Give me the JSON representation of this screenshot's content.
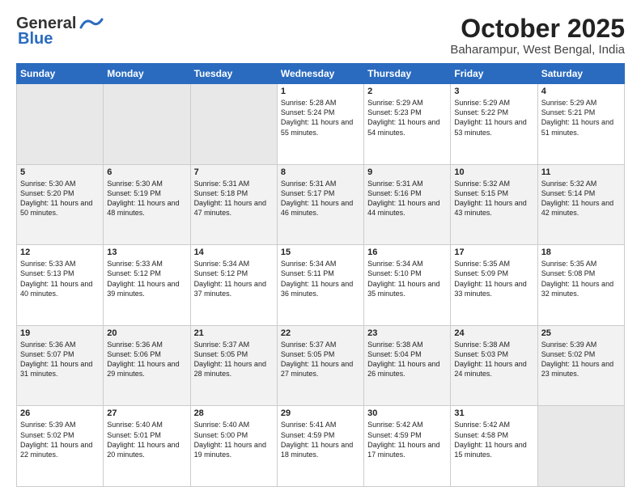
{
  "header": {
    "logo_line1": "General",
    "logo_line2": "Blue",
    "title": "October 2025",
    "subtitle": "Baharampur, West Bengal, India"
  },
  "days_of_week": [
    "Sunday",
    "Monday",
    "Tuesday",
    "Wednesday",
    "Thursday",
    "Friday",
    "Saturday"
  ],
  "weeks": [
    [
      {
        "day": "",
        "empty": true
      },
      {
        "day": "",
        "empty": true
      },
      {
        "day": "",
        "empty": true
      },
      {
        "day": "1",
        "sunrise": "5:28 AM",
        "sunset": "5:24 PM",
        "daylight": "11 hours and 55 minutes."
      },
      {
        "day": "2",
        "sunrise": "5:29 AM",
        "sunset": "5:23 PM",
        "daylight": "11 hours and 54 minutes."
      },
      {
        "day": "3",
        "sunrise": "5:29 AM",
        "sunset": "5:22 PM",
        "daylight": "11 hours and 53 minutes."
      },
      {
        "day": "4",
        "sunrise": "5:29 AM",
        "sunset": "5:21 PM",
        "daylight": "11 hours and 51 minutes."
      }
    ],
    [
      {
        "day": "5",
        "sunrise": "5:30 AM",
        "sunset": "5:20 PM",
        "daylight": "11 hours and 50 minutes."
      },
      {
        "day": "6",
        "sunrise": "5:30 AM",
        "sunset": "5:19 PM",
        "daylight": "11 hours and 48 minutes."
      },
      {
        "day": "7",
        "sunrise": "5:31 AM",
        "sunset": "5:18 PM",
        "daylight": "11 hours and 47 minutes."
      },
      {
        "day": "8",
        "sunrise": "5:31 AM",
        "sunset": "5:17 PM",
        "daylight": "11 hours and 46 minutes."
      },
      {
        "day": "9",
        "sunrise": "5:31 AM",
        "sunset": "5:16 PM",
        "daylight": "11 hours and 44 minutes."
      },
      {
        "day": "10",
        "sunrise": "5:32 AM",
        "sunset": "5:15 PM",
        "daylight": "11 hours and 43 minutes."
      },
      {
        "day": "11",
        "sunrise": "5:32 AM",
        "sunset": "5:14 PM",
        "daylight": "11 hours and 42 minutes."
      }
    ],
    [
      {
        "day": "12",
        "sunrise": "5:33 AM",
        "sunset": "5:13 PM",
        "daylight": "11 hours and 40 minutes."
      },
      {
        "day": "13",
        "sunrise": "5:33 AM",
        "sunset": "5:12 PM",
        "daylight": "11 hours and 39 minutes."
      },
      {
        "day": "14",
        "sunrise": "5:34 AM",
        "sunset": "5:12 PM",
        "daylight": "11 hours and 37 minutes."
      },
      {
        "day": "15",
        "sunrise": "5:34 AM",
        "sunset": "5:11 PM",
        "daylight": "11 hours and 36 minutes."
      },
      {
        "day": "16",
        "sunrise": "5:34 AM",
        "sunset": "5:10 PM",
        "daylight": "11 hours and 35 minutes."
      },
      {
        "day": "17",
        "sunrise": "5:35 AM",
        "sunset": "5:09 PM",
        "daylight": "11 hours and 33 minutes."
      },
      {
        "day": "18",
        "sunrise": "5:35 AM",
        "sunset": "5:08 PM",
        "daylight": "11 hours and 32 minutes."
      }
    ],
    [
      {
        "day": "19",
        "sunrise": "5:36 AM",
        "sunset": "5:07 PM",
        "daylight": "11 hours and 31 minutes."
      },
      {
        "day": "20",
        "sunrise": "5:36 AM",
        "sunset": "5:06 PM",
        "daylight": "11 hours and 29 minutes."
      },
      {
        "day": "21",
        "sunrise": "5:37 AM",
        "sunset": "5:05 PM",
        "daylight": "11 hours and 28 minutes."
      },
      {
        "day": "22",
        "sunrise": "5:37 AM",
        "sunset": "5:05 PM",
        "daylight": "11 hours and 27 minutes."
      },
      {
        "day": "23",
        "sunrise": "5:38 AM",
        "sunset": "5:04 PM",
        "daylight": "11 hours and 26 minutes."
      },
      {
        "day": "24",
        "sunrise": "5:38 AM",
        "sunset": "5:03 PM",
        "daylight": "11 hours and 24 minutes."
      },
      {
        "day": "25",
        "sunrise": "5:39 AM",
        "sunset": "5:02 PM",
        "daylight": "11 hours and 23 minutes."
      }
    ],
    [
      {
        "day": "26",
        "sunrise": "5:39 AM",
        "sunset": "5:02 PM",
        "daylight": "11 hours and 22 minutes."
      },
      {
        "day": "27",
        "sunrise": "5:40 AM",
        "sunset": "5:01 PM",
        "daylight": "11 hours and 20 minutes."
      },
      {
        "day": "28",
        "sunrise": "5:40 AM",
        "sunset": "5:00 PM",
        "daylight": "11 hours and 19 minutes."
      },
      {
        "day": "29",
        "sunrise": "5:41 AM",
        "sunset": "4:59 PM",
        "daylight": "11 hours and 18 minutes."
      },
      {
        "day": "30",
        "sunrise": "5:42 AM",
        "sunset": "4:59 PM",
        "daylight": "11 hours and 17 minutes."
      },
      {
        "day": "31",
        "sunrise": "5:42 AM",
        "sunset": "4:58 PM",
        "daylight": "11 hours and 15 minutes."
      },
      {
        "day": "",
        "empty": true
      }
    ]
  ],
  "labels": {
    "sunrise_label": "Sunrise:",
    "sunset_label": "Sunset:",
    "daylight_label": "Daylight:"
  }
}
